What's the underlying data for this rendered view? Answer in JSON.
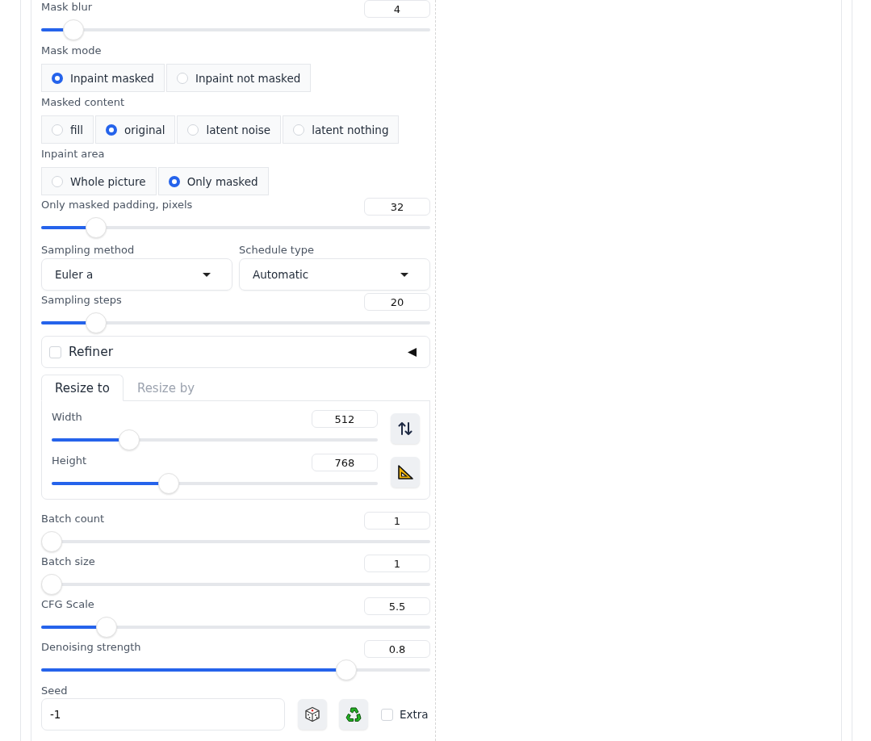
{
  "controls": [
    {
      "kind": "slider",
      "label": "Mask blur",
      "value": "4",
      "level": 0.06
    },
    {
      "kind": "radio",
      "label": "Mask mode",
      "options": [
        {
          "label": "Inpaint masked",
          "selected": true
        },
        {
          "label": "Inpaint not masked",
          "selected": false
        }
      ]
    },
    {
      "kind": "radio",
      "label": "Masked content",
      "options": [
        {
          "label": "fill",
          "selected": false
        },
        {
          "label": "original",
          "selected": true
        },
        {
          "label": "latent noise",
          "selected": false
        },
        {
          "label": "latent nothing",
          "selected": false
        }
      ]
    },
    {
      "kind": "radio",
      "label": "Inpaint area",
      "options": [
        {
          "label": "Whole picture",
          "selected": false
        },
        {
          "label": "Only masked",
          "selected": true
        }
      ]
    },
    {
      "kind": "slider",
      "label": "Only masked padding, pixels",
      "value": "32",
      "level": 0.12
    },
    {
      "kind": "dropdowns",
      "items": [
        {
          "label": "Sampling method",
          "value": "Euler a"
        },
        {
          "label": "Schedule type",
          "value": "Automatic"
        }
      ]
    },
    {
      "kind": "slider",
      "label": "Sampling steps",
      "value": "20",
      "level": 0.12
    },
    {
      "kind": "accordion",
      "label": "Refiner",
      "checked": false,
      "expanded": false
    },
    {
      "kind": "tabs",
      "tabs": [
        {
          "label": "Resize to",
          "selected": true
        },
        {
          "label": "Resize by",
          "selected": false
        }
      ],
      "sliders": [
        {
          "label": "Width",
          "value": "512",
          "level": 0.22
        },
        {
          "label": "Height",
          "value": "768",
          "level": 0.35
        }
      ]
    },
    {
      "kind": "slider",
      "label": "Batch count",
      "value": "1",
      "level": 0
    },
    {
      "kind": "slider",
      "label": "Batch size",
      "value": "1",
      "level": 0
    },
    {
      "kind": "slider",
      "label": "CFG Scale",
      "value": "5.5",
      "level": 0.15
    },
    {
      "kind": "slider",
      "label": "Denoising strength",
      "value": "0.8",
      "level": 0.8
    },
    {
      "kind": "seed",
      "label": "Seed",
      "value": "-1",
      "extra": {
        "label": "Extra",
        "checked": false
      }
    }
  ]
}
